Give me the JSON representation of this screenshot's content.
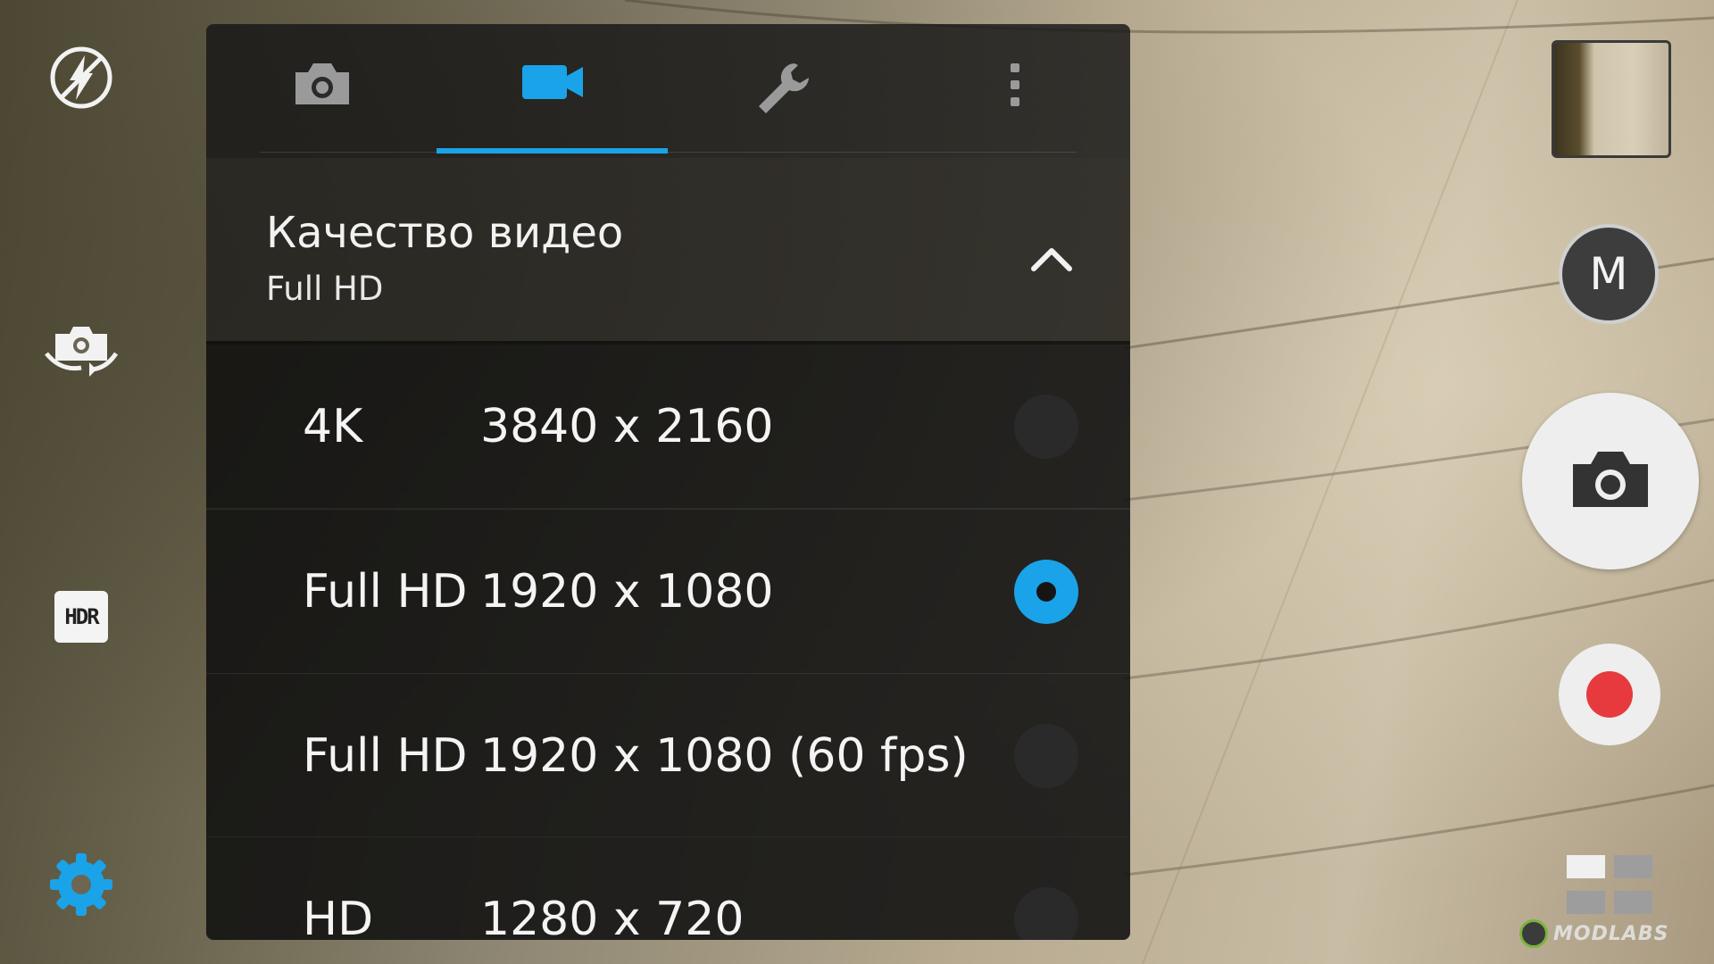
{
  "left_rail": {
    "flash": {
      "icon": "flash-auto-icon"
    },
    "switch_camera": {
      "icon": "switch-camera-icon"
    },
    "hdr": {
      "label": "HDR",
      "icon": "hdr-icon"
    },
    "settings": {
      "icon": "gear-icon",
      "color": "#1aa3e8"
    }
  },
  "panel": {
    "tabs": [
      {
        "name": "photo",
        "icon": "camera-icon",
        "active": false
      },
      {
        "name": "video",
        "icon": "video-camera-icon",
        "active": true
      },
      {
        "name": "tools",
        "icon": "wrench-icon",
        "active": false
      },
      {
        "name": "more",
        "icon": "more-vertical-icon",
        "active": false
      }
    ],
    "accent_color": "#1aa3e8",
    "section": {
      "title": "Качество видео",
      "value": "Full HD",
      "expanded": true
    },
    "options": [
      {
        "name": "4K",
        "resolution": "3840 x 2160",
        "selected": false
      },
      {
        "name": "Full HD",
        "resolution": "1920 x 1080",
        "selected": true
      },
      {
        "name": "Full HD",
        "resolution": "1920 x 1080 (60 fps)",
        "selected": false
      },
      {
        "name": "HD",
        "resolution": "1280 x 720",
        "selected": false
      }
    ]
  },
  "right_rail": {
    "mode_label": "M",
    "shutter": {
      "icon": "camera-icon"
    },
    "record": {
      "icon": "record-icon",
      "color": "#e63a3f"
    },
    "modes": {
      "icon": "grid-icon"
    },
    "watermark": "MODLABS"
  }
}
